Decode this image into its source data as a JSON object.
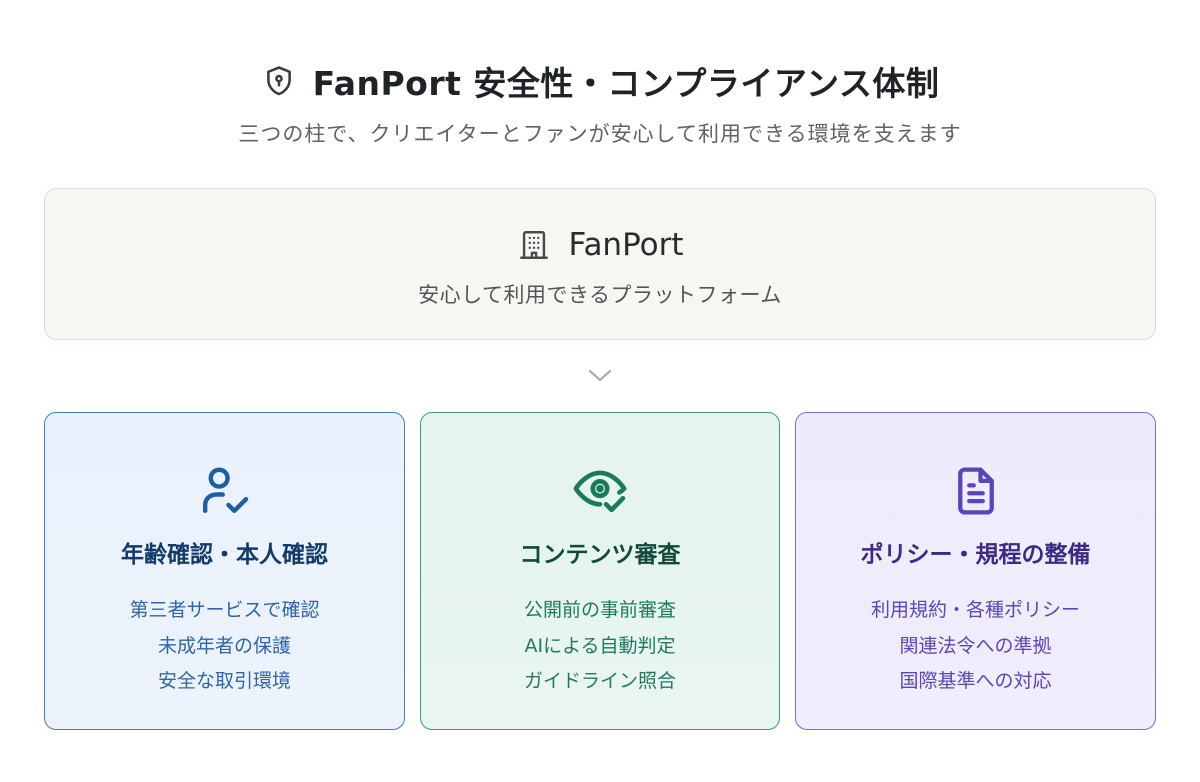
{
  "header": {
    "title": "FanPort 安全性・コンプライアンス体制",
    "title_icon": "shield-lock-icon",
    "subtitle": "三つの柱で、クリエイターとファンが安心して利用できる環境を支えます"
  },
  "platform": {
    "icon": "building-icon",
    "name": "FanPort",
    "description": "安心して利用できるプラットフォーム"
  },
  "connector_icon": "chevron-down-icon",
  "pillars": [
    {
      "icon": "user-check-icon",
      "title": "年齢確認・本人確認",
      "items": [
        "第三者サービスで確認",
        "未成年者の保護",
        "安全な取引環境"
      ],
      "accent": "#1a5fa8"
    },
    {
      "icon": "eye-check-icon",
      "title": "コンテンツ審査",
      "items": [
        "公開前の事前審査",
        "AIによる自動判定",
        "ガイドライン照合"
      ],
      "accent": "#1a7a5a"
    },
    {
      "icon": "document-icon",
      "title": "ポリシー・規程の整備",
      "items": [
        "利用規約・各種ポリシー",
        "関連法令への準拠",
        "国際基準への対応"
      ],
      "accent": "#5a45b8"
    }
  ]
}
